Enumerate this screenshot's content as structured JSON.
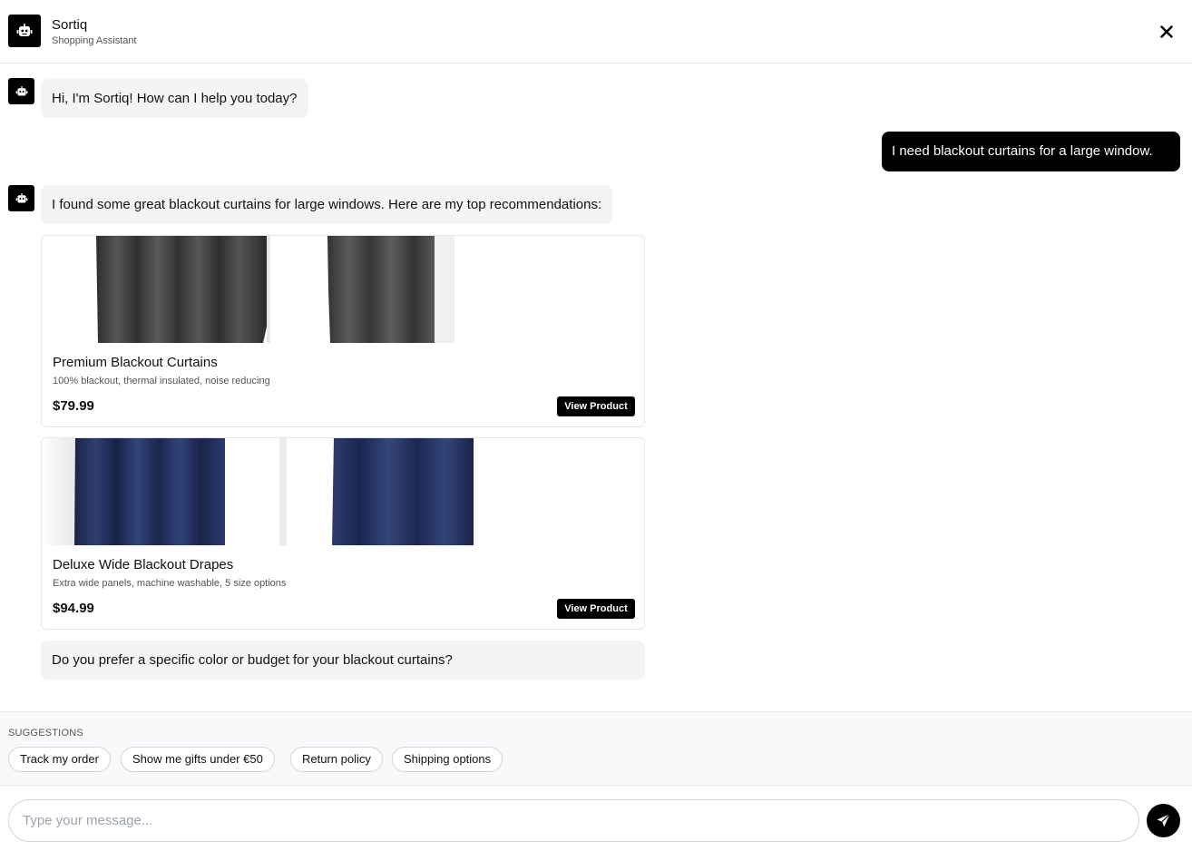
{
  "header": {
    "title": "Sortiq",
    "subtitle": "Shopping Assistant",
    "avatar_icon": "robot-icon",
    "close_icon": "close-icon"
  },
  "messages": [
    {
      "role": "bot",
      "text": "Hi, I'm Sortiq! How can I help you today?"
    },
    {
      "role": "user",
      "text": "I need blackout curtains for a large window."
    },
    {
      "role": "bot",
      "text": "I found some great blackout curtains for large windows. Here are my top recommendations:"
    },
    {
      "role": "bot",
      "text": "Do you prefer a specific color or budget for your blackout curtains?"
    }
  ],
  "products": [
    {
      "name": "Premium Blackout Curtains",
      "description": "100% blackout, thermal insulated, noise reducing",
      "price": "$79.99",
      "button_label": "View Product",
      "color": "#3a3a3a"
    },
    {
      "name": "Deluxe Wide Blackout Drapes",
      "description": "Extra wide panels, machine washable, 5 size options",
      "price": "$94.99",
      "button_label": "View Product",
      "color": "#1f2b52"
    }
  ],
  "suggestions": {
    "label": "SUGGESTIONS",
    "items": [
      "Track my order",
      "Show me gifts under €50",
      "Return policy",
      "Shipping options"
    ]
  },
  "composer": {
    "placeholder": "Type your message...",
    "value": "",
    "send_icon": "paper-plane-icon"
  },
  "colors": {
    "accent": "#000000",
    "bubble_bg": "#f3f4f6",
    "border": "#e5e7eb"
  }
}
